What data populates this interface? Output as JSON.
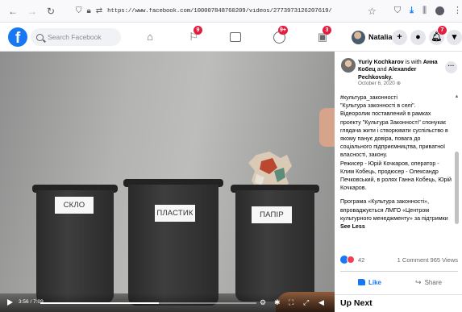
{
  "browser": {
    "back_icon": "arrow-left-icon",
    "forward_icon": "arrow-right-icon",
    "reload_icon": "reload-icon",
    "url": "https://www.facebook.com/100007848760209/videos/2773973126207619/",
    "icons": [
      "shield-icon",
      "lock-icon",
      "permissions-icon",
      "bookmark-star-icon",
      "pocket-icon",
      "download-icon",
      "library-icon",
      "extension-icon",
      "menu-icon"
    ]
  },
  "facebook": {
    "logo_letter": "f",
    "search_placeholder": "Search Facebook",
    "nav": {
      "home_icon": "home-icon",
      "pages_icon": "flag-icon",
      "pages_badge": "9",
      "watch_icon": "watch-icon",
      "groups_icon": "groups-icon",
      "groups_badge": "9+",
      "gaming_icon": "gaming-icon",
      "gaming_badge": "3"
    },
    "profile_name": "Natalia",
    "create_label": "+",
    "notifications_badge": "7",
    "accent_color": "#1877f2",
    "badge_color": "#e41e3f"
  },
  "video": {
    "bins": [
      "СКЛО",
      "ПЛАСТИК",
      "ПАПІР"
    ],
    "time": "3:56 / 7:09",
    "progress": 0.55
  },
  "post": {
    "author": "Yuriy Kochkarov",
    "with_text": "is with",
    "tagged_1": "Анна Кобец",
    "and_text": "and",
    "tagged_2": "Alexander Pechkovsky.",
    "date": "October 6, 2020",
    "privacy_icon": "globe-icon",
    "lines": [
      "#культура_законності",
      "\"Культура законності в селі\".",
      "Відеоролик поставлений в рамках проекту \"Культура Законності\" спонукає глядача жити і створювати суспільство в якому панує довіра, повага до соціального підприємництва, приватної власності, закону.",
      "Режисер - Юрій Кочкаров, оператор - Клим Кобець, продюсер - Олександр Печковський, в ролях Ганна Кобець, Юрій Кочкаров."
    ],
    "lines_2": [
      "Програма «Культура законності», впроваджується ЛМГО «Центром культурного менеджменту» за підтримки"
    ],
    "see_less": "See Less",
    "reaction_count": "42",
    "comments": "1 Comment",
    "views": "965 Views",
    "like_label": "Like",
    "share_label": "Share",
    "up_next": "Up Next"
  }
}
